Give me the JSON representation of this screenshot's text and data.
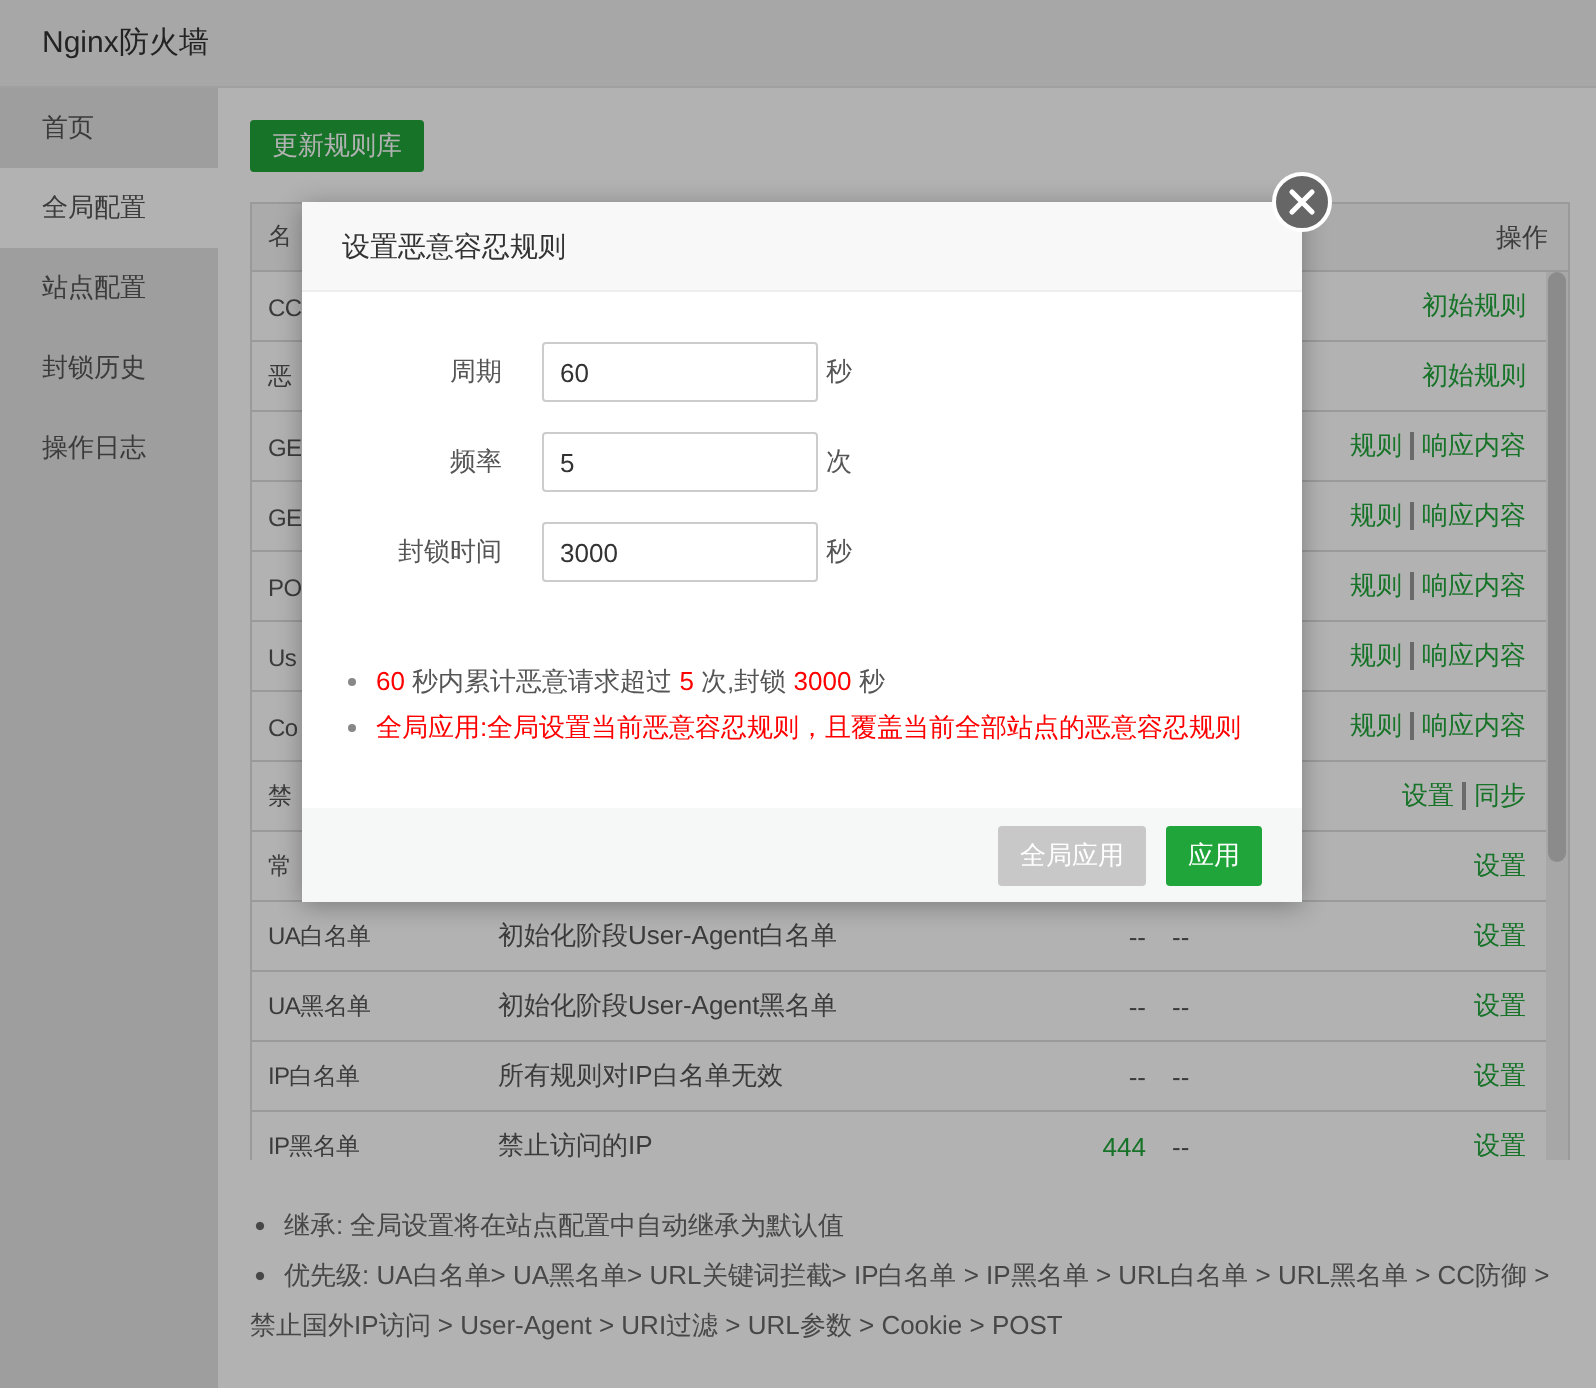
{
  "window": {
    "title": "Nginx防火墙"
  },
  "sidebar": {
    "items": [
      {
        "label": "首页",
        "selected": false
      },
      {
        "label": "全局配置",
        "selected": true
      },
      {
        "label": "站点配置",
        "selected": false
      },
      {
        "label": "封锁历史",
        "selected": false
      },
      {
        "label": "操作日志",
        "selected": false
      }
    ]
  },
  "toolbar": {
    "update_button": "更新规则库"
  },
  "table": {
    "columns": {
      "name": "名",
      "action": "操作"
    },
    "rows": [
      {
        "name": "CC",
        "actions": [
          "初始规则"
        ]
      },
      {
        "name": "恶",
        "actions": [
          "初始规则"
        ]
      },
      {
        "name": "GE",
        "actions": [
          "规则",
          "响应内容"
        ]
      },
      {
        "name": "GE",
        "actions": [
          "规则",
          "响应内容"
        ]
      },
      {
        "name": "PO",
        "actions": [
          "规则",
          "响应内容"
        ]
      },
      {
        "name": "Us",
        "actions": [
          "规则",
          "响应内容"
        ]
      },
      {
        "name": "Co",
        "actions": [
          "规则",
          "响应内容"
        ]
      },
      {
        "name": "禁",
        "actions": [
          "设置",
          "同步"
        ]
      },
      {
        "name": "常",
        "actions": [
          "设置"
        ]
      },
      {
        "name": "UA白名单",
        "description": "初始化阶段User-Agent白名单",
        "column_3": {
          "text": "--",
          "link": false
        },
        "column_4": "--",
        "actions": [
          "设置"
        ]
      },
      {
        "name": "UA黑名单",
        "description": "初始化阶段User-Agent黑名单",
        "column_3": {
          "text": "--",
          "link": false
        },
        "column_4": "--",
        "actions": [
          "设置"
        ]
      },
      {
        "name": "IP白名单",
        "description": "所有规则对IP白名单无效",
        "column_3": {
          "text": "--",
          "link": false
        },
        "column_4": "--",
        "actions": [
          "设置"
        ]
      },
      {
        "name": "IP黑名单",
        "description": "禁止访问的IP",
        "column_3": {
          "text": "444",
          "link": true
        },
        "column_4": "--",
        "actions": [
          "设置"
        ]
      }
    ]
  },
  "notes": [
    "继承: 全局设置将在站点配置中自动继承为默认值",
    "优先级: UA白名单> UA黑名单> URL关键词拦截> IP白名单 > IP黑名单 > URL白名单 > URL黑名单 > CC防御 > 禁止国外IP访问 > User-Agent > URI过滤 > URL参数 > Cookie > POST"
  ],
  "modal": {
    "title": "设置恶意容忍规则",
    "fields": [
      {
        "label": "周期",
        "value": "60",
        "unit": "秒"
      },
      {
        "label": "频率",
        "value": "5",
        "unit": "次"
      },
      {
        "label": "封锁时间",
        "value": "3000",
        "unit": "秒"
      }
    ],
    "summary": [
      {
        "text": "60",
        "emphasis": true
      },
      {
        "text": " 秒内累计恶意请求超过 ",
        "emphasis": false
      },
      {
        "text": "5",
        "emphasis": true
      },
      {
        "text": " 次,封锁 ",
        "emphasis": false
      },
      {
        "text": "3000",
        "emphasis": true
      },
      {
        "text": " 秒",
        "emphasis": false
      }
    ],
    "warning": "全局应用:全局设置当前恶意容忍规则，且覆盖当前全部站点的恶意容忍规则",
    "buttons": [
      {
        "label": "全局应用",
        "disabled": true
      },
      {
        "label": "应用",
        "disabled": false
      }
    ]
  }
}
